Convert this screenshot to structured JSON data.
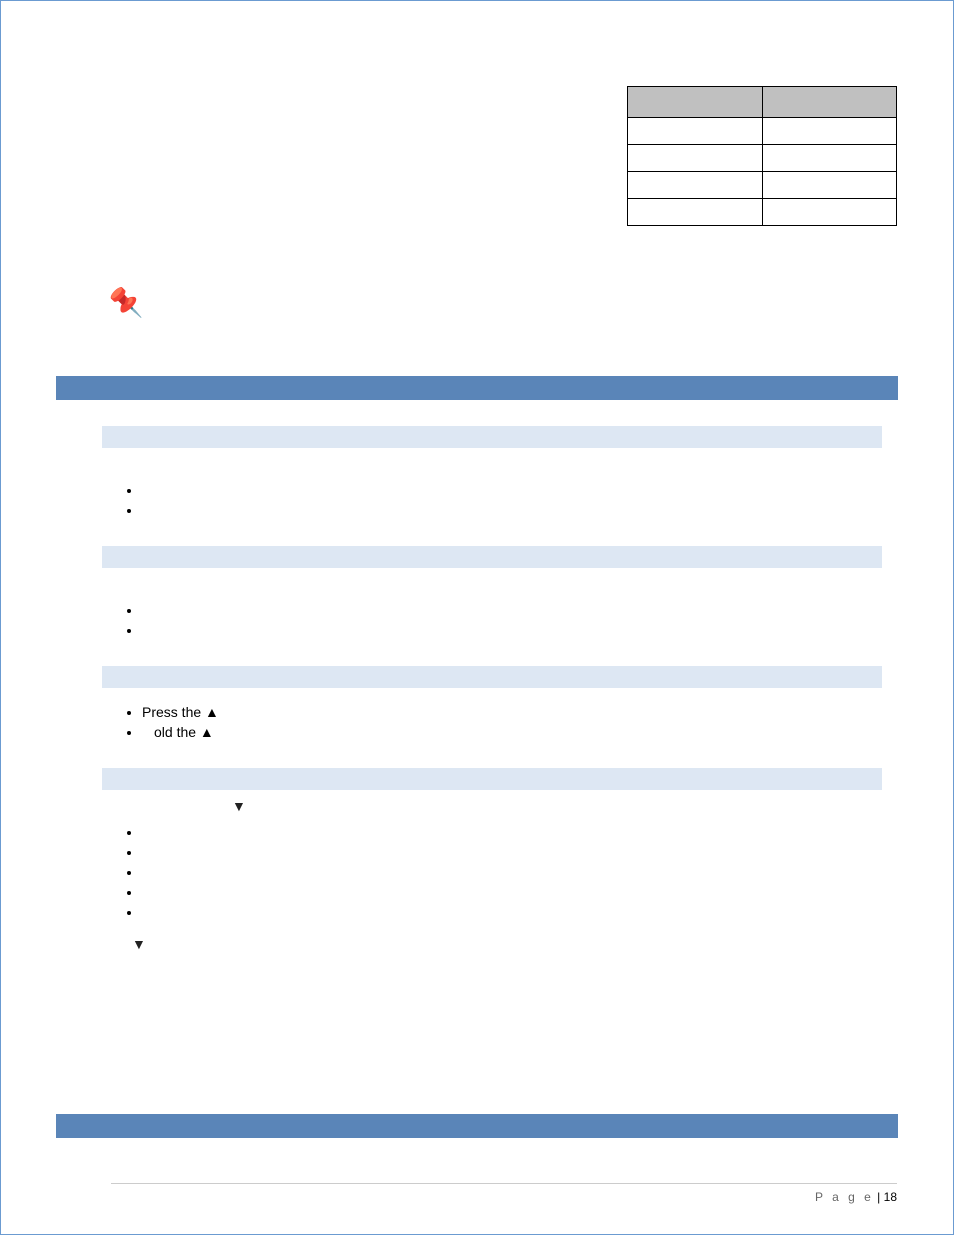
{
  "table": {
    "row_count": 4
  },
  "sections": [
    {
      "subs": [
        {
          "bullets": [
            "",
            ""
          ]
        },
        {
          "bullets": [
            "",
            ""
          ]
        },
        {
          "bullets": [
            "Press the ▲",
            "old the ▲"
          ]
        },
        {
          "intro_after": "▼",
          "bullets": [
            "",
            "",
            "",
            "",
            ""
          ],
          "tail": "▼"
        }
      ]
    }
  ],
  "footer": {
    "label": "P a g e",
    "sep": " | ",
    "num": "18"
  }
}
